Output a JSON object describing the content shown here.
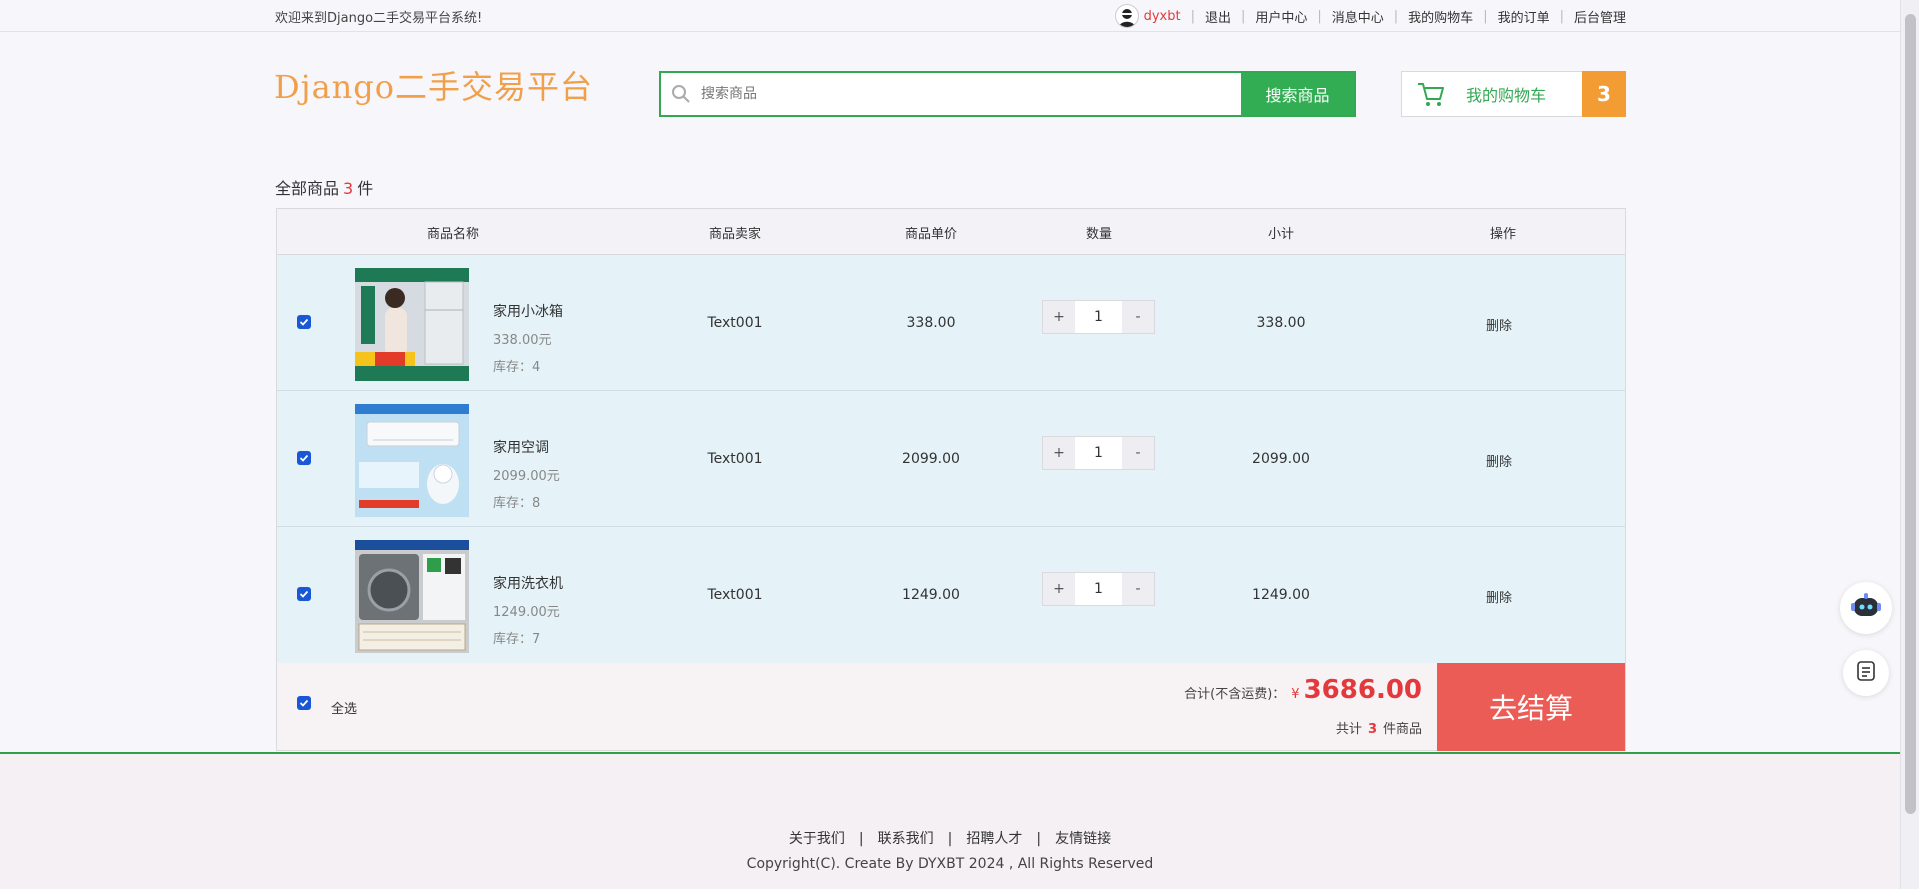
{
  "topbar": {
    "welcome": "欢迎来到Django二手交易平台系统!",
    "username": "dyxbt",
    "links": [
      "退出",
      "用户中心",
      "消息中心",
      "我的购物车",
      "我的订单",
      "后台管理"
    ]
  },
  "header": {
    "logo": "Django二手交易平台",
    "search_placeholder": "搜索商品",
    "search_button": "搜索商品",
    "cart_label": "我的购物车",
    "cart_count": "3"
  },
  "cart": {
    "count_prefix": "全部商品",
    "count": "3",
    "count_suffix": "件",
    "columns": [
      "商品名称",
      "商品卖家",
      "商品单价",
      "数量",
      "小计",
      "操作"
    ],
    "items": [
      {
        "name": "家用小冰箱",
        "price_text": "338.00元",
        "stock": "库存：4",
        "seller": "Text001",
        "unit_price": "338.00",
        "qty": "1",
        "subtotal": "338.00",
        "action": "删除"
      },
      {
        "name": "家用空调",
        "price_text": "2099.00元",
        "stock": "库存：8",
        "seller": "Text001",
        "unit_price": "2099.00",
        "qty": "1",
        "subtotal": "2099.00",
        "action": "删除"
      },
      {
        "name": "家用洗衣机",
        "price_text": "1249.00元",
        "stock": "库存：7",
        "seller": "Text001",
        "unit_price": "1249.00",
        "qty": "1",
        "subtotal": "1249.00",
        "action": "删除"
      }
    ],
    "stepper_plus": "+",
    "stepper_minus": "-",
    "select_all": "全选",
    "total_label": "合计(不含运费)：",
    "currency": "¥",
    "total": "3686.00",
    "items_prefix": "共计",
    "items_count": "3",
    "items_suffix": "件商品",
    "checkout": "去结算"
  },
  "footer": {
    "links": [
      "关于我们",
      "联系我们",
      "招聘人才",
      "友情链接"
    ],
    "copyright": "Copyright(C). Create By DYXBT 2024 , All Rights Reserved"
  },
  "colors": {
    "brand_green": "#33ad54",
    "accent_orange": "#f39c34",
    "price_red": "#e4393c",
    "checkout_red": "#ec5c57"
  }
}
